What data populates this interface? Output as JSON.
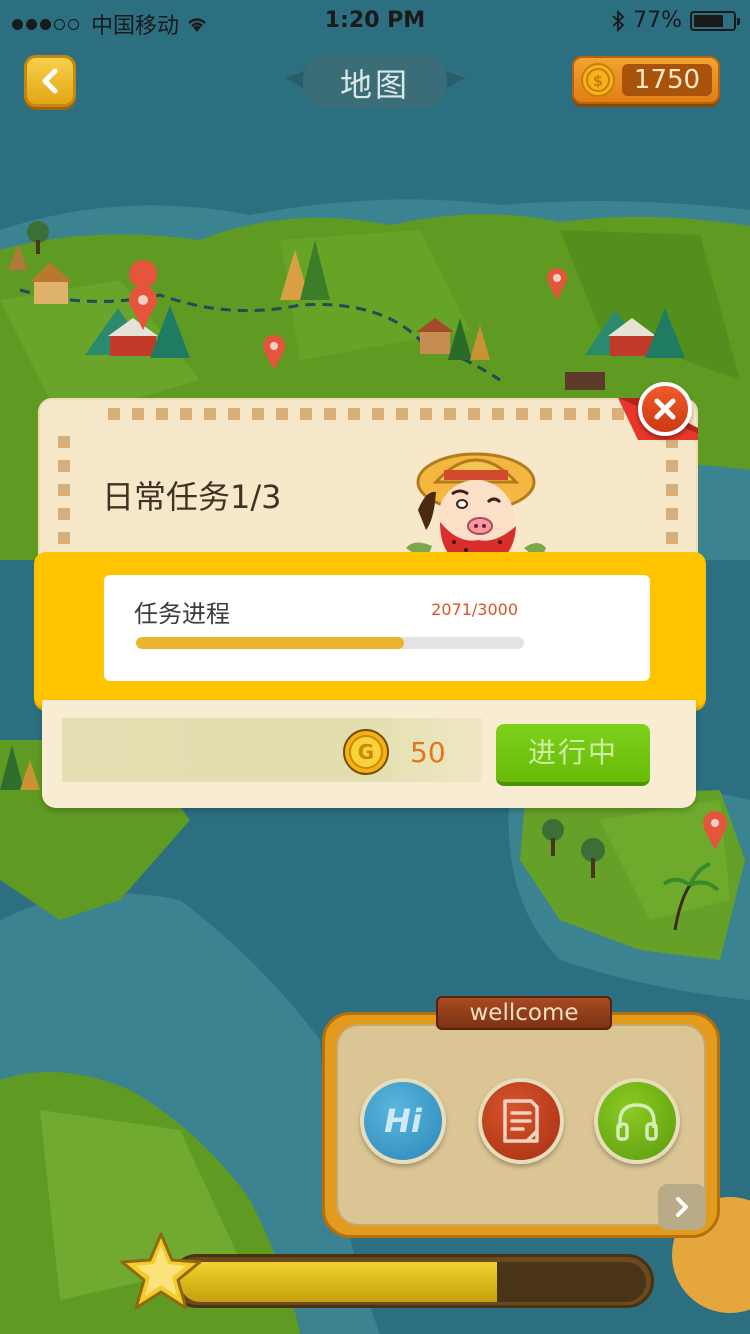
{
  "status_bar": {
    "carrier": "中国移动",
    "time": "1:20 PM",
    "battery": "77%"
  },
  "header": {
    "title": "地图",
    "coins": "1750"
  },
  "dialog": {
    "title": "日常任务1/3",
    "progress_label": "任务进程",
    "progress_count": "2071/3000",
    "progress_value": 2071,
    "progress_total": 3000,
    "reward_amount": "50",
    "status_button": "进行中"
  },
  "panel": {
    "tag": "wellcome",
    "hi_label": "Hi"
  },
  "experience": {
    "fraction": 0.68
  },
  "colors": {
    "sea": "#2b6f80",
    "land": "#5f9a23",
    "accent_yellow": "#ffc300",
    "progress_fill": "#ecb32c",
    "status_green": "#72c410"
  }
}
